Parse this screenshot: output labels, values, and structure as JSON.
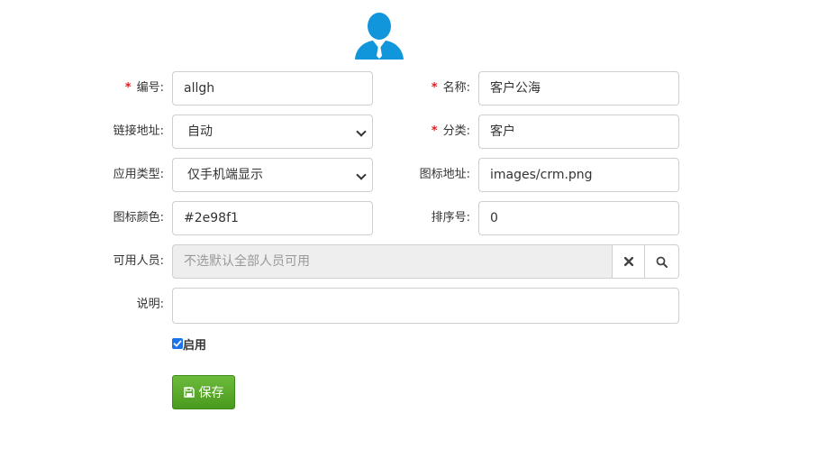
{
  "form": {
    "code": {
      "label": "编号:",
      "value": "allgh"
    },
    "name": {
      "label": "名称:",
      "value": "客户公海"
    },
    "link": {
      "label": "链接地址:",
      "value": "自动"
    },
    "category": {
      "label": "分类:",
      "value": "客户"
    },
    "app_type": {
      "label": "应用类型:",
      "value": "仅手机端显示"
    },
    "icon_url": {
      "label": "图标地址:",
      "value": "images/crm.png"
    },
    "icon_color": {
      "label": "图标颜色:",
      "value": "#2e98f1"
    },
    "sort_no": {
      "label": "排序号:",
      "value": "0"
    },
    "users": {
      "label": "可用人员:",
      "placeholder": "不选默认全部人员可用"
    },
    "desc": {
      "label": "说明:",
      "value": ""
    },
    "enabled": {
      "label": "启用",
      "checked": true
    },
    "required_mark": "*"
  },
  "save_button": {
    "label": "保存"
  },
  "icons": {
    "avatar": "user-avatar-icon",
    "clear": "times-icon",
    "search": "search-icon",
    "save": "floppy-disk-icon",
    "checkbox": "check-icon"
  },
  "colors": {
    "avatar": "#1296db",
    "save": "#52a62b",
    "required": "#e02020",
    "checkbox": "#1a73e8"
  }
}
